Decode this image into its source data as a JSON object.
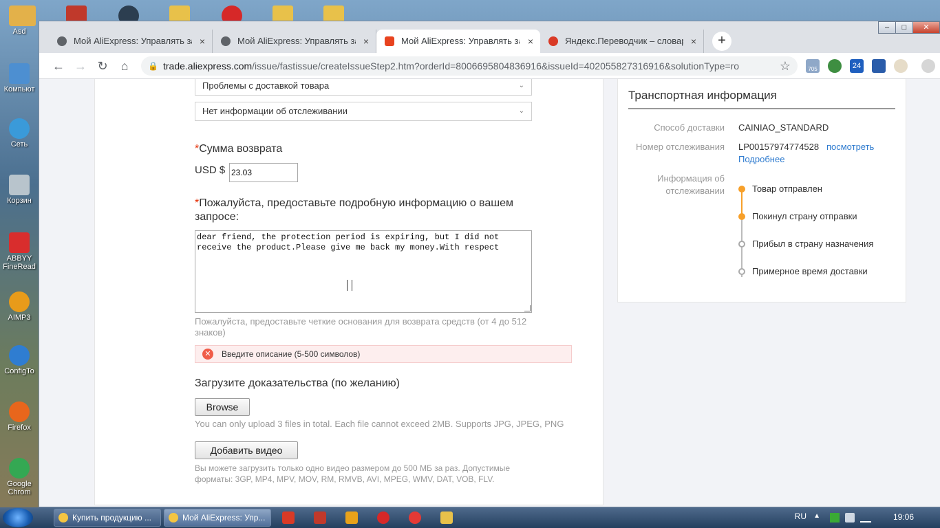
{
  "desktop": {
    "icons": [
      {
        "label": "Asd",
        "color": "#e3b14a"
      },
      {
        "label": "Компьют",
        "color": "#4d8fd1"
      },
      {
        "label": "Сеть",
        "color": "#3a9ad9"
      },
      {
        "label": "Корзин",
        "color": "#b8c4cc"
      },
      {
        "label": "ABBYY FineRead",
        "color": "#d92d2d"
      },
      {
        "label": "AIMP3",
        "color": "#e89b1a"
      },
      {
        "label": "ConfigTo",
        "color": "#2f7dd1"
      },
      {
        "label": "Firefox",
        "color": "#e8661c"
      },
      {
        "label": "Google Chrom",
        "color": "#34a853"
      }
    ]
  },
  "tabs": [
    {
      "label": "Мой AliExpress: Управлять заказ",
      "favicon": "globe-icon",
      "close": "×"
    },
    {
      "label": "Мой AliExpress: Управлять заказ",
      "favicon": "globe-icon",
      "close": "×"
    },
    {
      "label": "Мой AliExpress: Управлять заказ",
      "favicon": "aliexpress-icon",
      "close": "×",
      "active": true
    },
    {
      "label": "Яндекс.Переводчик – словарь и",
      "favicon": "yandex-translate-icon",
      "close": "×"
    }
  ],
  "newtab": "+",
  "window_controls": {
    "minimize": "–",
    "maximize": "□",
    "close": "✕"
  },
  "toolbar": {
    "back": "←",
    "forward": "→",
    "reload": "↻",
    "home": "⌂",
    "lock": "🔒",
    "url_host": "trade.aliexpress.com",
    "url_path": "/issue/fastissue/createIssueStep2.htm?orderId=8006695804836916&issueId=402055827316916&solutionType=ro",
    "star": "☆",
    "ext_badge_1": "705",
    "ext_badge_2": "24"
  },
  "form": {
    "problem_select": "Проблемы с доставкой товара",
    "reason_select": "Нет информации об отслеживании",
    "chevron": "⌄",
    "refund_label": "Сумма возврата",
    "required_mark": "*",
    "currency": "USD $",
    "refund_value": "23.03",
    "details_label": "Пожалуйста, предоставьте подробную информацию о вашем запросе:",
    "details_text": "dear friend, the protection period is expiring, but I did not receive the product.Please give me back my money.With respect",
    "details_hint": "Пожалуйста, предоставьте четкие основания для возврата средств (от 4 до 512 знаков)",
    "error_icon": "✕",
    "error_text": "Введите описание (5-500 символов)",
    "evidence_label": "Загрузите доказательства (по желанию)",
    "browse_button": "Browse",
    "upload_hint": "You can only upload 3 files in total. Each file cannot exceed 2MB. Supports JPG, JPEG, PNG",
    "add_video_button": "Добавить видео",
    "video_hint": "Вы можете загрузить только одно видео размером до 500 МБ за раз. Допустимые форматы: 3GP, MP4, MPV, MOV, RM, RMVB, AVI, MPEG, WMV, DAT, VOB, FLV."
  },
  "shipping": {
    "title": "Транспортная информация",
    "method_label": "Способ доставки",
    "method_value": "CAINIAO_STANDARD",
    "tracking_label": "Номер отслеживания",
    "tracking_value": "LP00157974774528",
    "tracking_link": "посмотреть",
    "more_link": "Подробнее",
    "status_label": "Информация об отслеживании",
    "timeline": [
      {
        "text": "Товар отправлен",
        "done": true
      },
      {
        "text": "Покинул страну отправки",
        "done": true
      },
      {
        "text": "Прибыл в страну назначения",
        "done": false
      },
      {
        "text": "Примерное время доставки",
        "done": false
      }
    ],
    "accent": "#f7a02a"
  },
  "taskbar": {
    "tasks": [
      {
        "label": "Купить продукцию ..."
      },
      {
        "label": "Мой AliExpress: Упр..."
      }
    ],
    "lang": "RU",
    "clock": "19:06"
  }
}
